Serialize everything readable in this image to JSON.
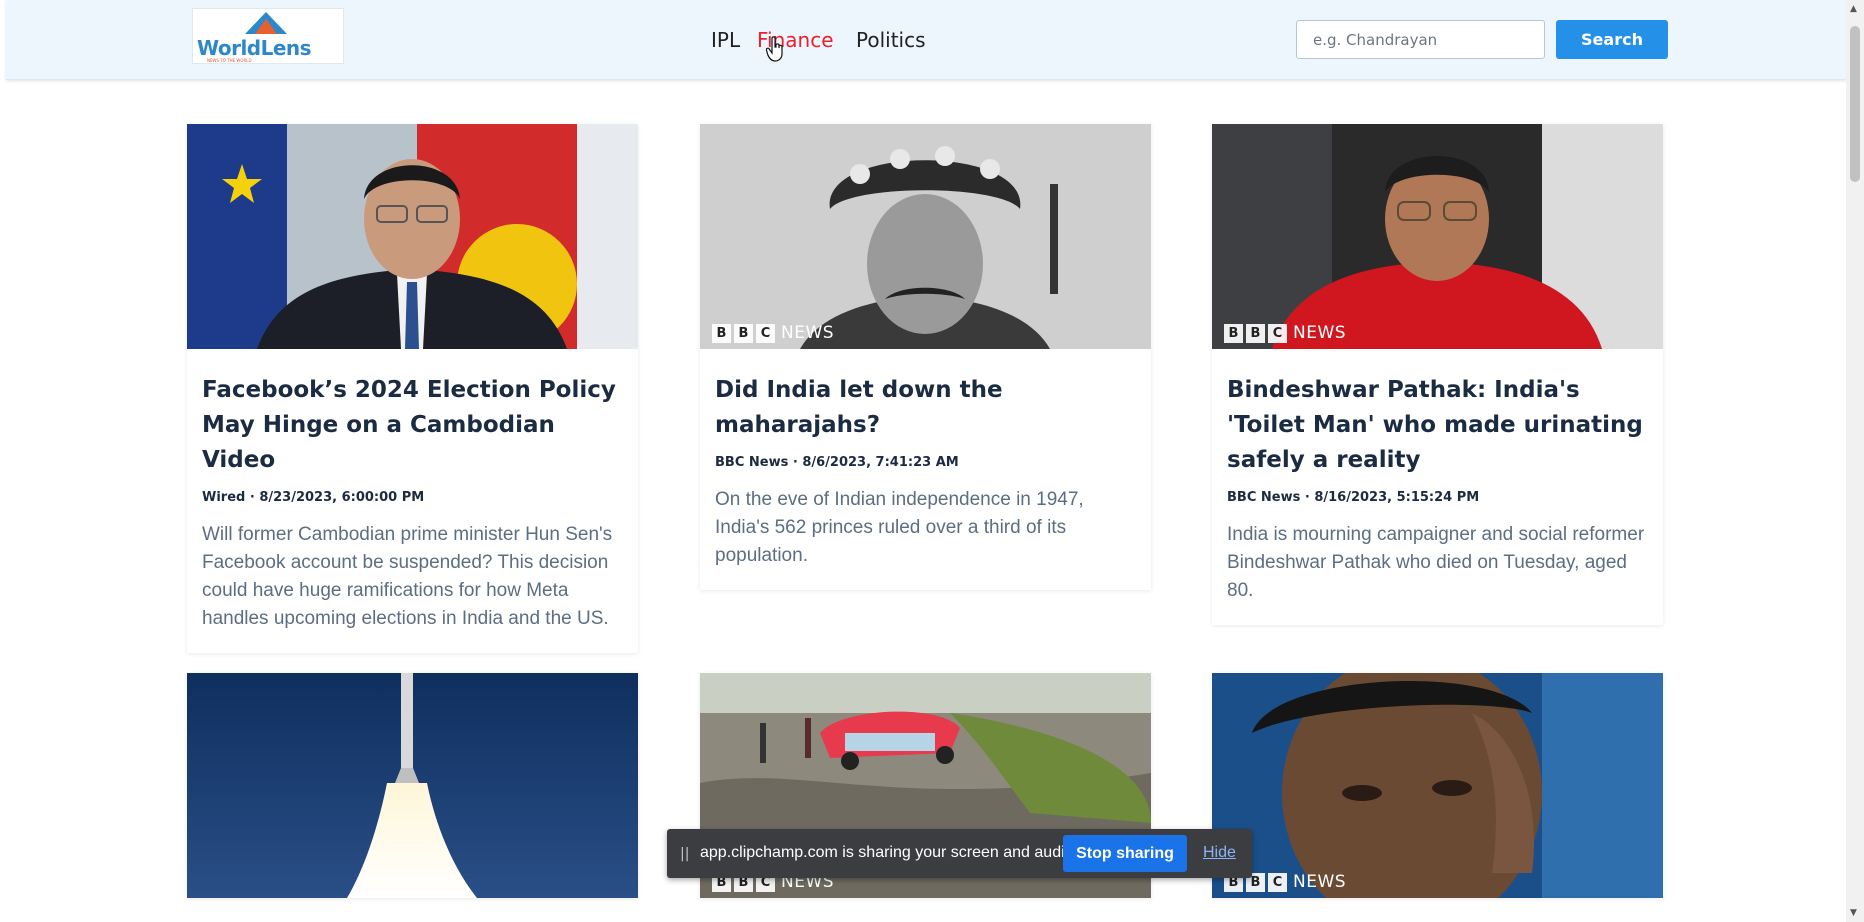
{
  "header": {
    "logo_text": "WorldLens",
    "logo_tagline": "NEWS TO THE WORLD",
    "nav": [
      {
        "label": "IPL"
      },
      {
        "label": "Finance"
      },
      {
        "label": "Politics"
      }
    ],
    "active_nav": "Finance",
    "search": {
      "placeholder": "e.g. Chandrayan",
      "value": "",
      "button_label": "Search"
    }
  },
  "articles": [
    {
      "title": "Facebook’s 2024 Election Policy May Hinge on a Cambodian Video",
      "meta": "Wired · 8/23/2023, 6:00:00 PM",
      "description": "Will former Cambodian prime minister Hun Sen's Facebook account be suspended? This decision could have huge ramifications for how Meta handles upcoming elections in India and the US.",
      "bbc_logo": false
    },
    {
      "title": "Did India let down the maharajahs?",
      "meta": "BBC News · 8/6/2023, 7:41:23 AM",
      "description": "On the eve of Indian independence in 1947, India's 562 princes ruled over a third of its population.",
      "bbc_logo": true
    },
    {
      "title": "Bindeshwar Pathak: India's 'Toilet Man' who made urinating safely a reality",
      "meta": "BBC News · 8/16/2023, 5:15:24 PM",
      "description": "India is mourning campaigner and social reformer Bindeshwar Pathak who died on Tuesday, aged 80.",
      "bbc_logo": true
    },
    {
      "bbc_logo": false
    },
    {
      "bbc_logo": true
    },
    {
      "bbc_logo": true
    }
  ],
  "bbc_letters": [
    "B",
    "B",
    "C"
  ],
  "bbc_news_label": "NEWS",
  "share_bar": {
    "grip": "||",
    "message": "app.clipchamp.com is sharing your screen and audio.",
    "stop_label": "Stop sharing",
    "hide_label": "Hide"
  },
  "colors": {
    "navbar_bg": "#edf6fd",
    "accent": "#2590e8",
    "active_nav": "#e8212d",
    "title_text": "#1b2b41",
    "description_text": "#5c6e82"
  }
}
